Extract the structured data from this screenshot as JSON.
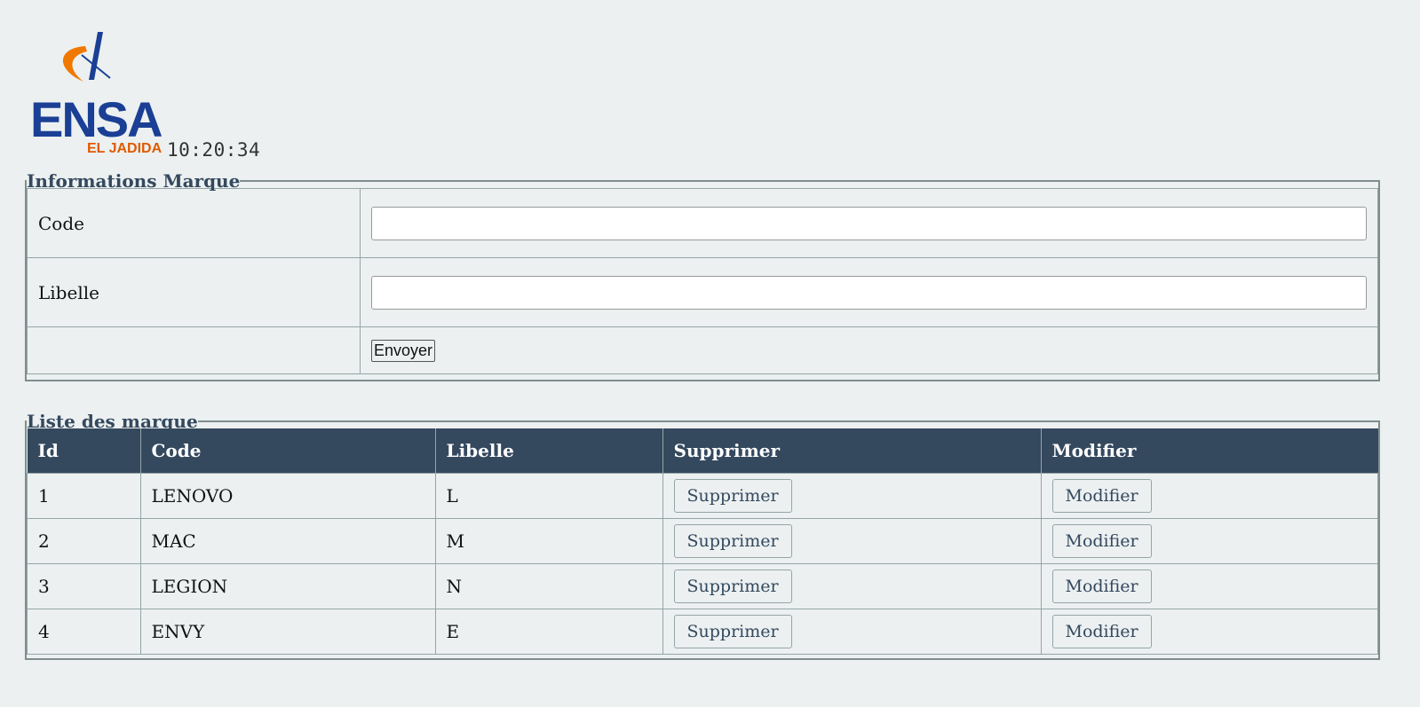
{
  "header": {
    "logo_text": "ENSA",
    "logo_subtext": "EL JADIDA",
    "clock": "10:20:34"
  },
  "form": {
    "legend": "Informations Marque",
    "code_label": "Code",
    "code_value": "",
    "libelle_label": "Libelle",
    "libelle_value": "",
    "submit_label": "Envoyer"
  },
  "list": {
    "legend": "Liste des marque",
    "columns": [
      "Id",
      "Code",
      "Libelle",
      "Supprimer",
      "Modifier"
    ],
    "rows": [
      {
        "id": "1",
        "code": "LENOVO",
        "libelle": "L"
      },
      {
        "id": "2",
        "code": "MAC",
        "libelle": "M"
      },
      {
        "id": "3",
        "code": "LEGION",
        "libelle": "N"
      },
      {
        "id": "4",
        "code": "ENVY",
        "libelle": "E"
      }
    ],
    "delete_label": "Supprimer",
    "edit_label": "Modifier"
  },
  "colors": {
    "background": "#ecf0f1",
    "header_bg": "#34495e",
    "logo_blue": "#1a3f95",
    "logo_orange": "#f07800"
  }
}
